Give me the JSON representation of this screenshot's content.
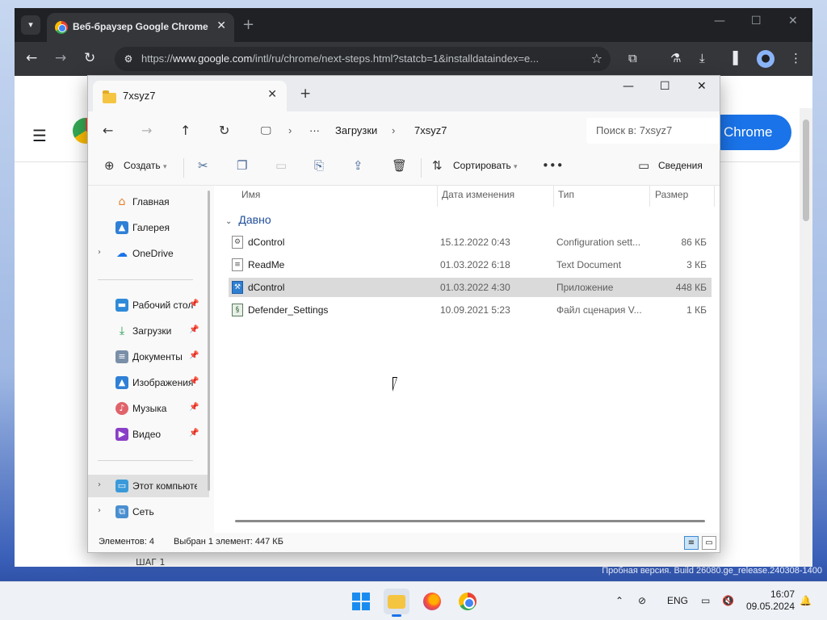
{
  "chrome": {
    "tab_title": "Веб-браузер Google Chrome",
    "url_prefix": "https://",
    "url_host": "www.google.com",
    "url_rest": "/intl/ru/chrome/next-steps.html?statcb=1&installdataindex=e...",
    "page_button": "Chrome",
    "page_step": "ШАГ 1"
  },
  "explorer": {
    "tab_title": "7xsyz7",
    "breadcrumb": [
      "Загрузки",
      "7xsyz7"
    ],
    "search_placeholder": "Поиск в: 7xsyz7",
    "toolbar": {
      "create": "Создать",
      "sort": "Сортировать",
      "details": "Сведения"
    },
    "nav": {
      "home": "Главная",
      "gallery": "Галерея",
      "onedrive": "OneDrive",
      "desktop": "Рабочий стол",
      "downloads": "Загрузки",
      "documents": "Документы",
      "pictures": "Изображения",
      "music": "Музыка",
      "video": "Видео",
      "this_pc": "Этот компьютер",
      "network": "Сеть"
    },
    "columns": {
      "name": "Имя",
      "date": "Дата изменения",
      "type": "Тип",
      "size": "Размер"
    },
    "group": "Давно",
    "files": [
      {
        "name": "dControl",
        "date": "15.12.2022 0:43",
        "type": "Configuration sett...",
        "size": "86 КБ"
      },
      {
        "name": "ReadMe",
        "date": "01.03.2022 6:18",
        "type": "Text Document",
        "size": "3 КБ"
      },
      {
        "name": "dControl",
        "date": "01.03.2022 4:30",
        "type": "Приложение",
        "size": "448 КБ"
      },
      {
        "name": "Defender_Settings",
        "date": "10.09.2021 5:23",
        "type": "Файл сценария V...",
        "size": "1 КБ"
      }
    ],
    "status": {
      "count": "Элементов: 4",
      "selected": "Выбран 1 элемент: 447 КБ"
    }
  },
  "desktop": {
    "watermark": "Пробная версия. Build 26080.ge_release.240308-1400"
  },
  "taskbar": {
    "lang": "ENG",
    "time": "16:07",
    "date": "09.05.2024"
  }
}
